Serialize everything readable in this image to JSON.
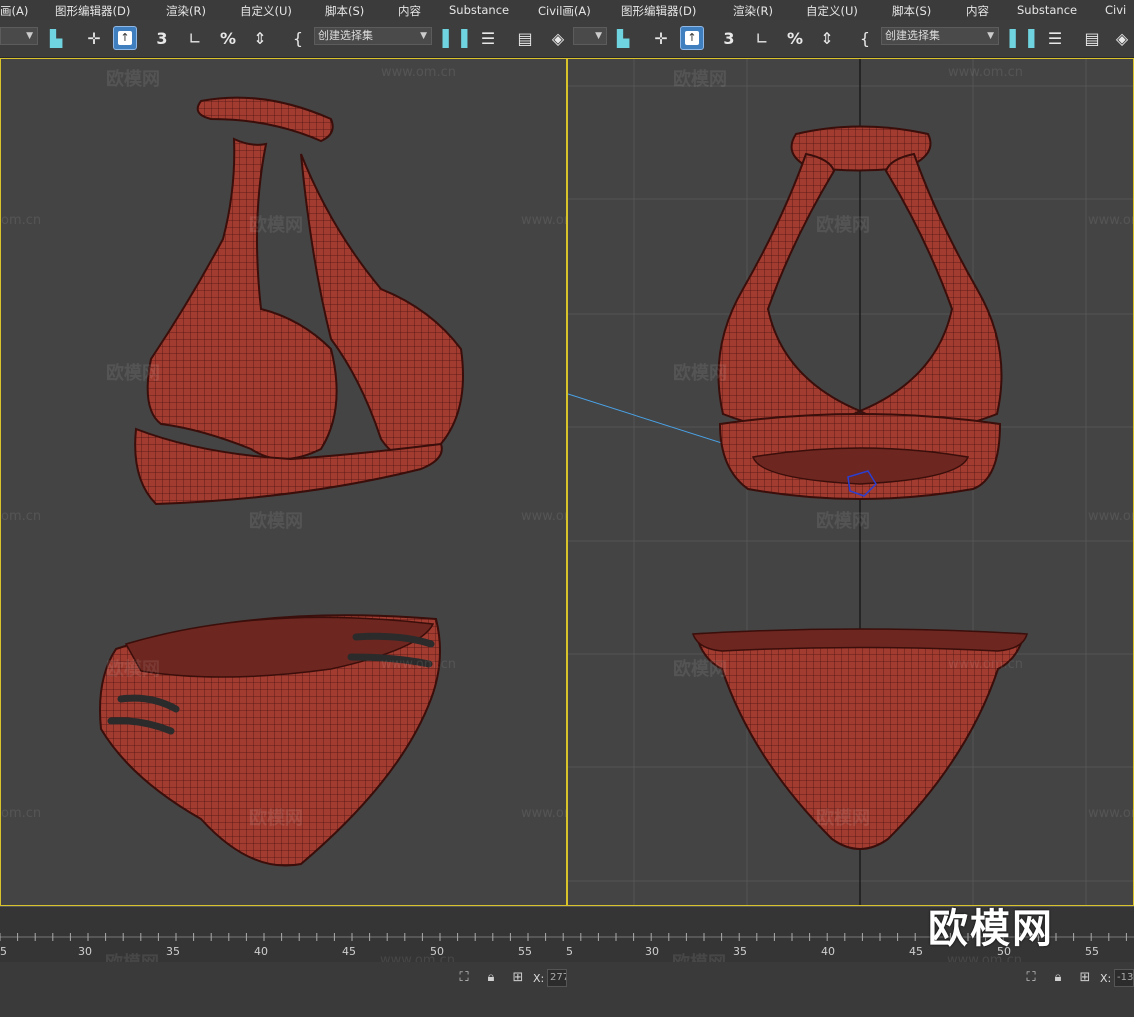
{
  "menubar": {
    "items": [
      "画(A)",
      "图形编辑器(D)",
      "渲染(R)",
      "自定义(U)",
      "脚本(S)",
      "内容",
      "Substance",
      "Civil画(A)",
      "图形编辑器(D)",
      "渲染(R)",
      "自定义(U)",
      "脚本(S)",
      "内容",
      "Substance",
      "Civi"
    ]
  },
  "toolbar": {
    "selection_set_left": "创建选择集",
    "selection_set_right": "创建选择集",
    "snap_label": "3",
    "percent_label": "%"
  },
  "watermarks": {
    "brand_cn": "欧模网",
    "site": "www.om.cn",
    "site_short": "om.cn"
  },
  "timeline": {
    "left_ticks": [
      "5",
      "30",
      "35",
      "40",
      "45",
      "50",
      "55"
    ],
    "right_ticks": [
      "5",
      "30",
      "35",
      "40",
      "45",
      "50",
      "55"
    ]
  },
  "status": {
    "x_label": "X:",
    "x_value_left": "277",
    "x_value_right": "-13"
  },
  "brand_logo": "欧模网",
  "colors": {
    "viewport_border": "#d8c42a",
    "mesh_fill": "#9a3a30",
    "mesh_line": "#3a0e0a",
    "active_button": "#3f7fc0"
  }
}
